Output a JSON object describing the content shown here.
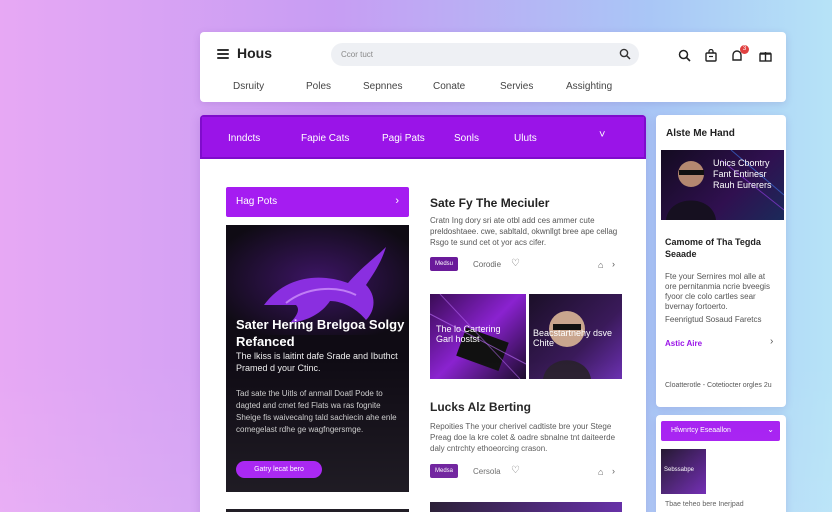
{
  "header": {
    "logo": "Hous",
    "search_placeholder": "Ccor tuct",
    "icons": [
      "search-icon",
      "bag-icon",
      "notification-icon",
      "gift-icon"
    ],
    "notification_count": "3",
    "nav": [
      "Dsruity",
      "Poles",
      "Sepnnes",
      "Conate",
      "Servies",
      "Assighting"
    ]
  },
  "purple_nav": {
    "items": [
      "Inndcts",
      "Fapie Cats",
      "Pagi Pats",
      "Sonls",
      "Uluts"
    ],
    "chevron": "˅"
  },
  "hot_posts": {
    "label": "Hag Pots",
    "arrow": "›"
  },
  "feature": {
    "title": "Sater Hering Brelgoa Solgy Refanced",
    "subtitle": "The lkiss is laitint dafe Srade and Ibuthct Pramed d your Ctinc.",
    "body": "Tad sate the Uitls of anmall Doatl Pode to dagted and cmet fed Flats wa ras fognite Sheige fis waivecalng tald sachiecin ahe enle comegelast rdhe ge wagfngersmge.",
    "button": "Gatry lecat bero"
  },
  "article1": {
    "title": "Sate Fy The Meciuler",
    "desc": "Cratn Ing dory sri ate otbl add ces ammer cute preldoshtaee. cwe, sabltald, okwnllgt bree ape cellag Rsgo te sund cet ot yor acs cifer.",
    "tag": "Medsu",
    "meta": "Corodie"
  },
  "thumb1": {
    "caption": "The lo Cartering Garl hostst"
  },
  "thumb2": {
    "caption": "Beacstartnehy dsve Chite"
  },
  "article2": {
    "title": "Lucks Alz Berting",
    "desc": "Repoities The your cherivel cadtiste bre your Stege Preag doe la kre colet & oadre sbnalne tnt daiteerde daly cntrchty ethoeorcing crason.",
    "tag": "Medsa",
    "meta": "Cersola"
  },
  "sidebar": {
    "card1": {
      "title": "Alste Me Hand",
      "image_caption": "Unics Cbontry Fant Entinesr Rauh Eurerers",
      "headline": "Camome of Tha Tegda Seaade",
      "body": "Fte your Sernires mol alle at ore pernitanmia ncrie bveegis fyoor cle colo cartles sear bvernay fortoerto.",
      "meta_line": "Feenrigtud Sosaud Faretcs",
      "link": "Astic Aire",
      "footer": "Cloatterotle - Cotetiocter orgles 2u"
    },
    "card2": {
      "bar_label": "Hfwnrtcy Eseaallon",
      "thumb_caption": "Sebssabpe",
      "footer": "Tbae teheo bere Inerjpad"
    }
  },
  "colors": {
    "accent": "#9a14e8",
    "tag": "#6a1a9a",
    "dark": "#0f0b14"
  }
}
